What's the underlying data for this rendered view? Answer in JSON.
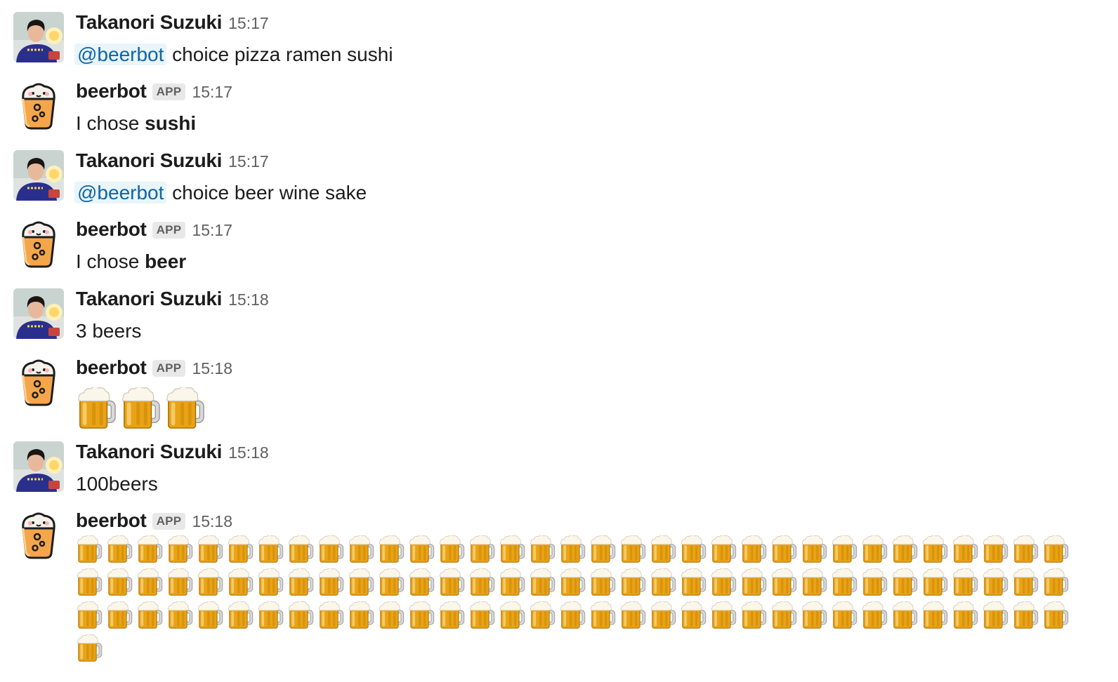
{
  "users": {
    "human": {
      "name": "Takanori Suzuki",
      "avatar_icon": "user-photo-avatar"
    },
    "bot": {
      "name": "beerbot",
      "badge": "APP",
      "avatar_icon": "beer-glass-face-icon"
    }
  },
  "messages": [
    {
      "author": "Takanori Suzuki",
      "time": "15:17",
      "mention": "@beerbot",
      "text": " choice pizza ramen sushi"
    },
    {
      "author": "beerbot",
      "badge": "APP",
      "time": "15:17",
      "prefix": "I chose ",
      "bold": "sushi"
    },
    {
      "author": "Takanori Suzuki",
      "time": "15:17",
      "mention": "@beerbot",
      "text": " choice beer wine sake"
    },
    {
      "author": "beerbot",
      "badge": "APP",
      "time": "15:17",
      "prefix": "I chose ",
      "bold": "beer"
    },
    {
      "author": "Takanori Suzuki",
      "time": "15:18",
      "text": "3 beers"
    },
    {
      "author": "beerbot",
      "badge": "APP",
      "time": "15:18",
      "emoji": "beer-mug-icon",
      "emoji_count": 3
    },
    {
      "author": "Takanori Suzuki",
      "time": "15:18",
      "text": "100beers"
    },
    {
      "author": "beerbot",
      "badge": "APP",
      "time": "15:18",
      "emoji": "beer-mug-icon",
      "emoji_count": 100
    }
  ],
  "colors": {
    "mention_bg": "#e8f5fa",
    "mention_fg": "#1264a3",
    "timestamp": "#616061",
    "badge_bg": "#e8e8e8"
  }
}
